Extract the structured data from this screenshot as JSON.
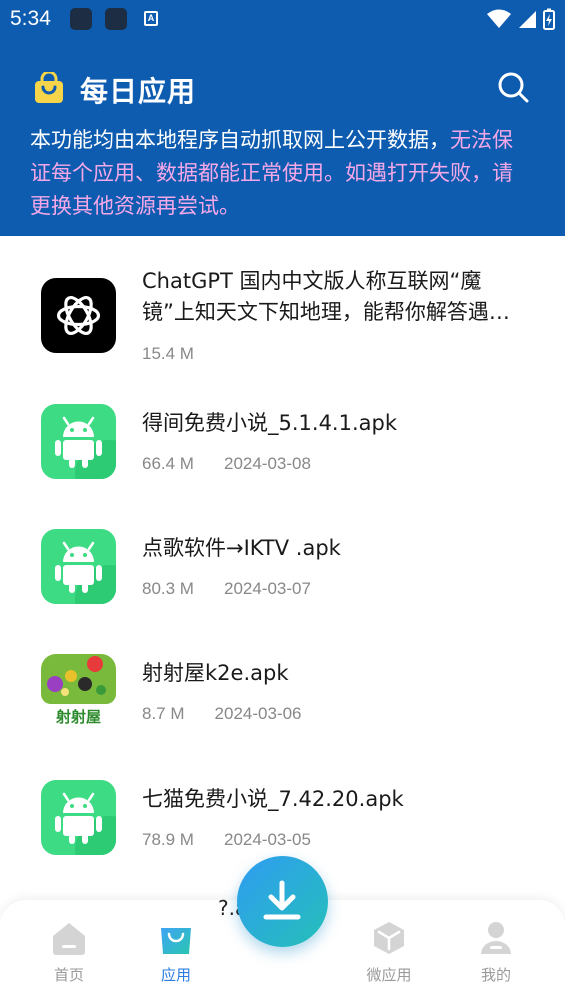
{
  "status_bar": {
    "time": "5:34",
    "notif_letter": "A"
  },
  "header": {
    "title": "每日应用",
    "notice_normal": "本功能均由本地程序自动抓取网上公开数据，",
    "notice_highlight": "无法保证每个应用、数据都能正常使用。如遇打开失败，请更换其他资源再尝试。"
  },
  "apps": [
    {
      "name_line1": "ChatGPT 国内中文版人称互联网“魔",
      "name_line2": "镜”上知天文下知地理，能帮你解答遇…",
      "size": "15.4 M",
      "date": "",
      "icon": "chatgpt-icon"
    },
    {
      "name": "得间免费小说_5.1.4.1.apk",
      "size": "66.4 M",
      "date": "2024-03-08",
      "icon": "android-icon"
    },
    {
      "name": "点歌软件→IKTV .apk",
      "size": "80.3 M",
      "date": "2024-03-07",
      "icon": "android-icon"
    },
    {
      "name": "射射屋k2e.apk",
      "size": "8.7 M",
      "date": "2024-03-06",
      "icon": "sheshewu-icon",
      "icon_text": "射射屋"
    },
    {
      "name": "七猫免费小说_7.42.20.apk",
      "size": "78.9 M",
      "date": "2024-03-05",
      "icon": "android-icon"
    }
  ],
  "partial_row_text": "?.a",
  "tabs": [
    {
      "label": "首页",
      "icon": "home-icon",
      "active": false
    },
    {
      "label": "应用",
      "icon": "shopping-bag-icon",
      "active": true
    },
    {
      "label": "微应用",
      "icon": "cube-icon",
      "active": false
    },
    {
      "label": "我的",
      "icon": "user-icon",
      "active": false
    }
  ],
  "colors": {
    "header_bg": "#0d5cb0",
    "highlight": "#f5a8e8",
    "android_green": "#3ddc84",
    "active_tab": "#2c7de0"
  }
}
